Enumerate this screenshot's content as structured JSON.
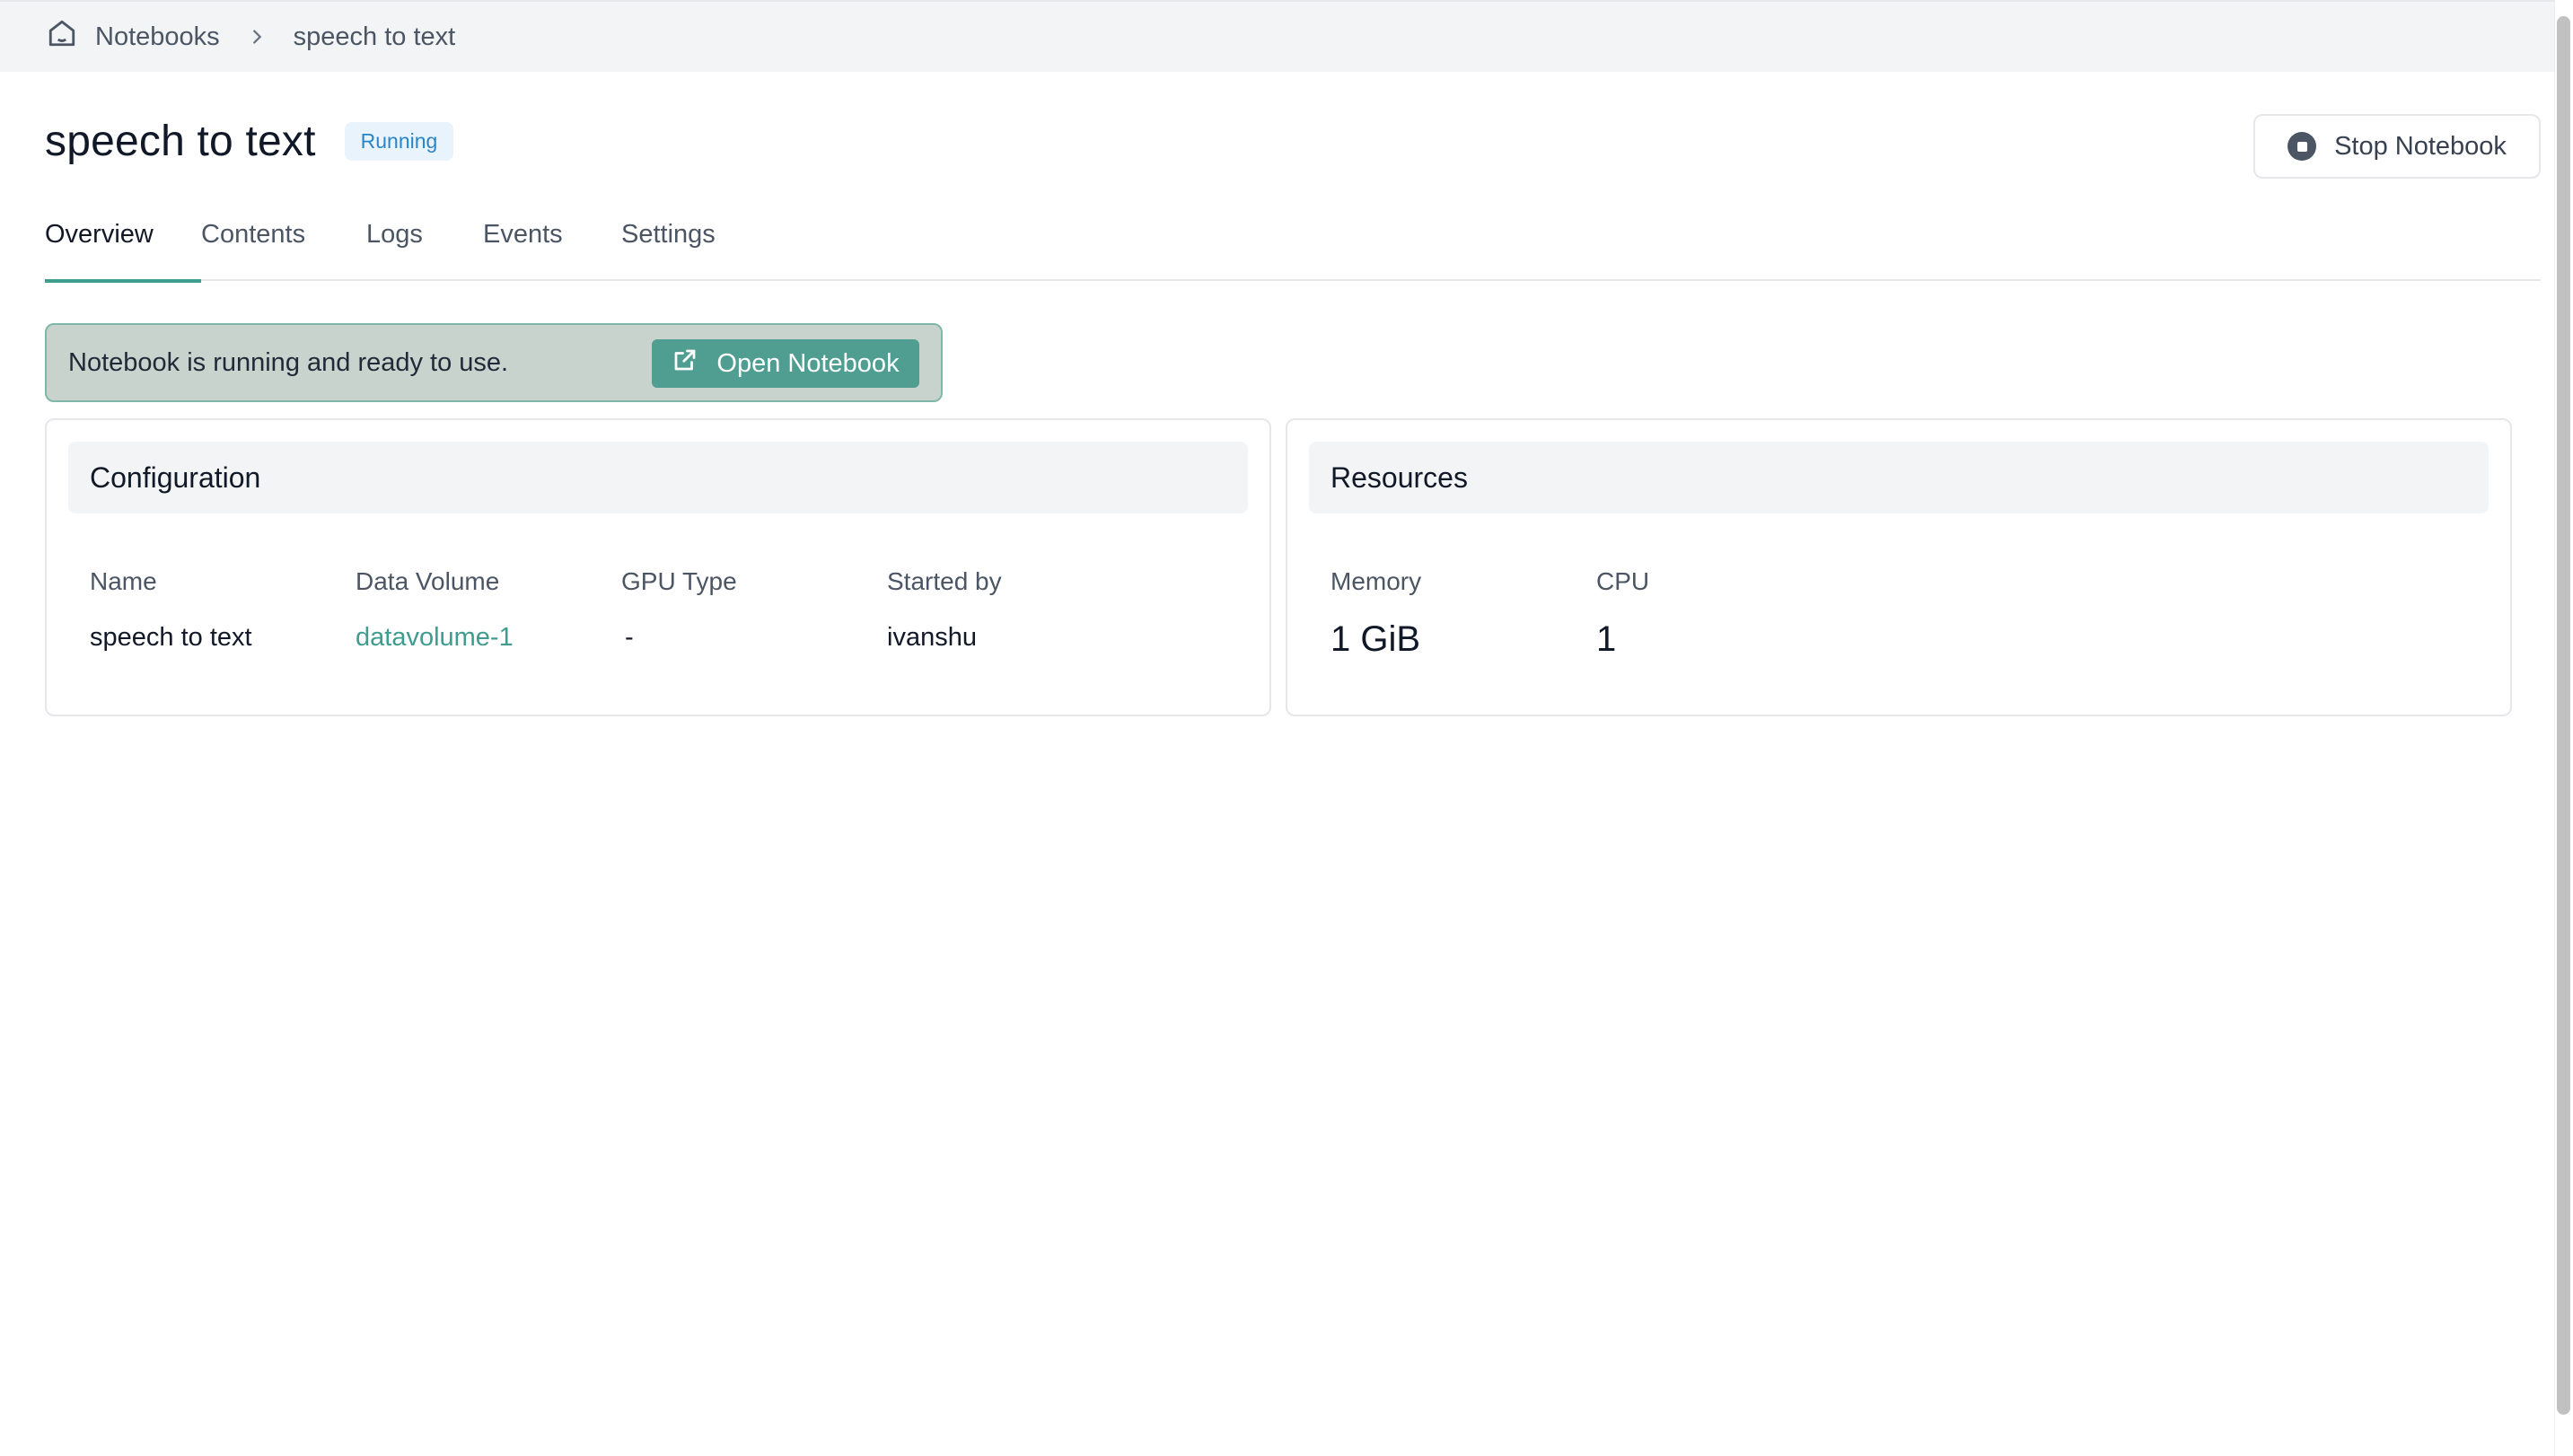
{
  "breadcrumb": {
    "home_label": "Notebooks",
    "current": "speech to text"
  },
  "header": {
    "title": "speech to text",
    "status": "Running",
    "stop_label": "Stop Notebook"
  },
  "tabs": [
    {
      "label": "Overview",
      "active": true
    },
    {
      "label": "Contents",
      "active": false
    },
    {
      "label": "Logs",
      "active": false
    },
    {
      "label": "Events",
      "active": false
    },
    {
      "label": "Settings",
      "active": false
    }
  ],
  "banner": {
    "message": "Notebook is running and ready to use.",
    "open_label": "Open Notebook"
  },
  "configuration": {
    "title": "Configuration",
    "fields": [
      {
        "label": "Name",
        "value": "speech to text"
      },
      {
        "label": "Data Volume",
        "value": "datavolume-1"
      },
      {
        "label": "GPU Type",
        "value": "-"
      },
      {
        "label": "Started by",
        "value": "ivanshu"
      }
    ]
  },
  "resources": {
    "title": "Resources",
    "fields": [
      {
        "label": "Memory",
        "value": "1 GiB"
      },
      {
        "label": "CPU",
        "value": "1"
      }
    ]
  },
  "colors": {
    "accent": "#3f9c8f",
    "status_text": "#2b85c6",
    "banner_bg": "#c9d3cd"
  }
}
